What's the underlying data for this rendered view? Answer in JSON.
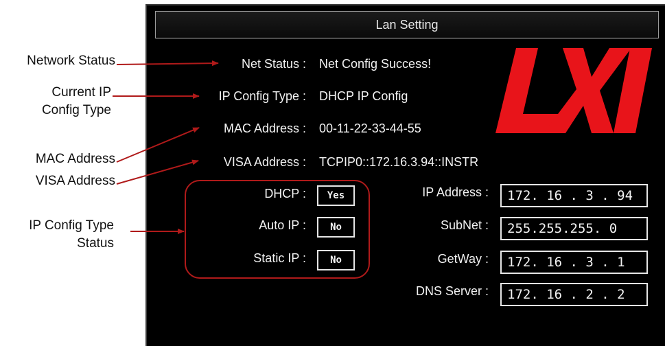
{
  "window": {
    "title": "Lan Setting"
  },
  "callouts": {
    "network_status": "Network Status",
    "current_ip_config_type_line1": "Current IP",
    "current_ip_config_type_line2": "Config Type",
    "mac_address": "MAC Address",
    "visa_address": "VISA Address",
    "ip_config_type_status_line1": "IP Config Type",
    "ip_config_type_status_line2": "Status"
  },
  "info": {
    "net_status_label": "Net Status :",
    "net_status_value": "Net Config Success!",
    "ip_config_type_label": "IP Config Type :",
    "ip_config_type_value": "DHCP IP Config",
    "mac_label": "MAC Address :",
    "mac_value": "00-11-22-33-44-55",
    "visa_label": "VISA Address :",
    "visa_value": "TCPIP0::172.16.3.94::INSTR"
  },
  "config_types": [
    {
      "label": "DHCP :",
      "value": "Yes"
    },
    {
      "label": "Auto IP :",
      "value": "No"
    },
    {
      "label": "Static IP :",
      "value": "No"
    }
  ],
  "network": [
    {
      "label": "IP Address :",
      "value": "172. 16 . 3 . 94"
    },
    {
      "label": "SubNet :",
      "value": "255.255.255. 0"
    },
    {
      "label": "GetWay :",
      "value": "172. 16 . 3 . 1"
    },
    {
      "label": "DNS Server :",
      "value": "172. 16 . 2 . 2"
    }
  ],
  "logo": {
    "text": "LXI",
    "color": "#e8141a"
  },
  "colors": {
    "annotation_line": "#b01a1a",
    "panel_bg": "#000000",
    "panel_text": "#f2f2f2"
  }
}
